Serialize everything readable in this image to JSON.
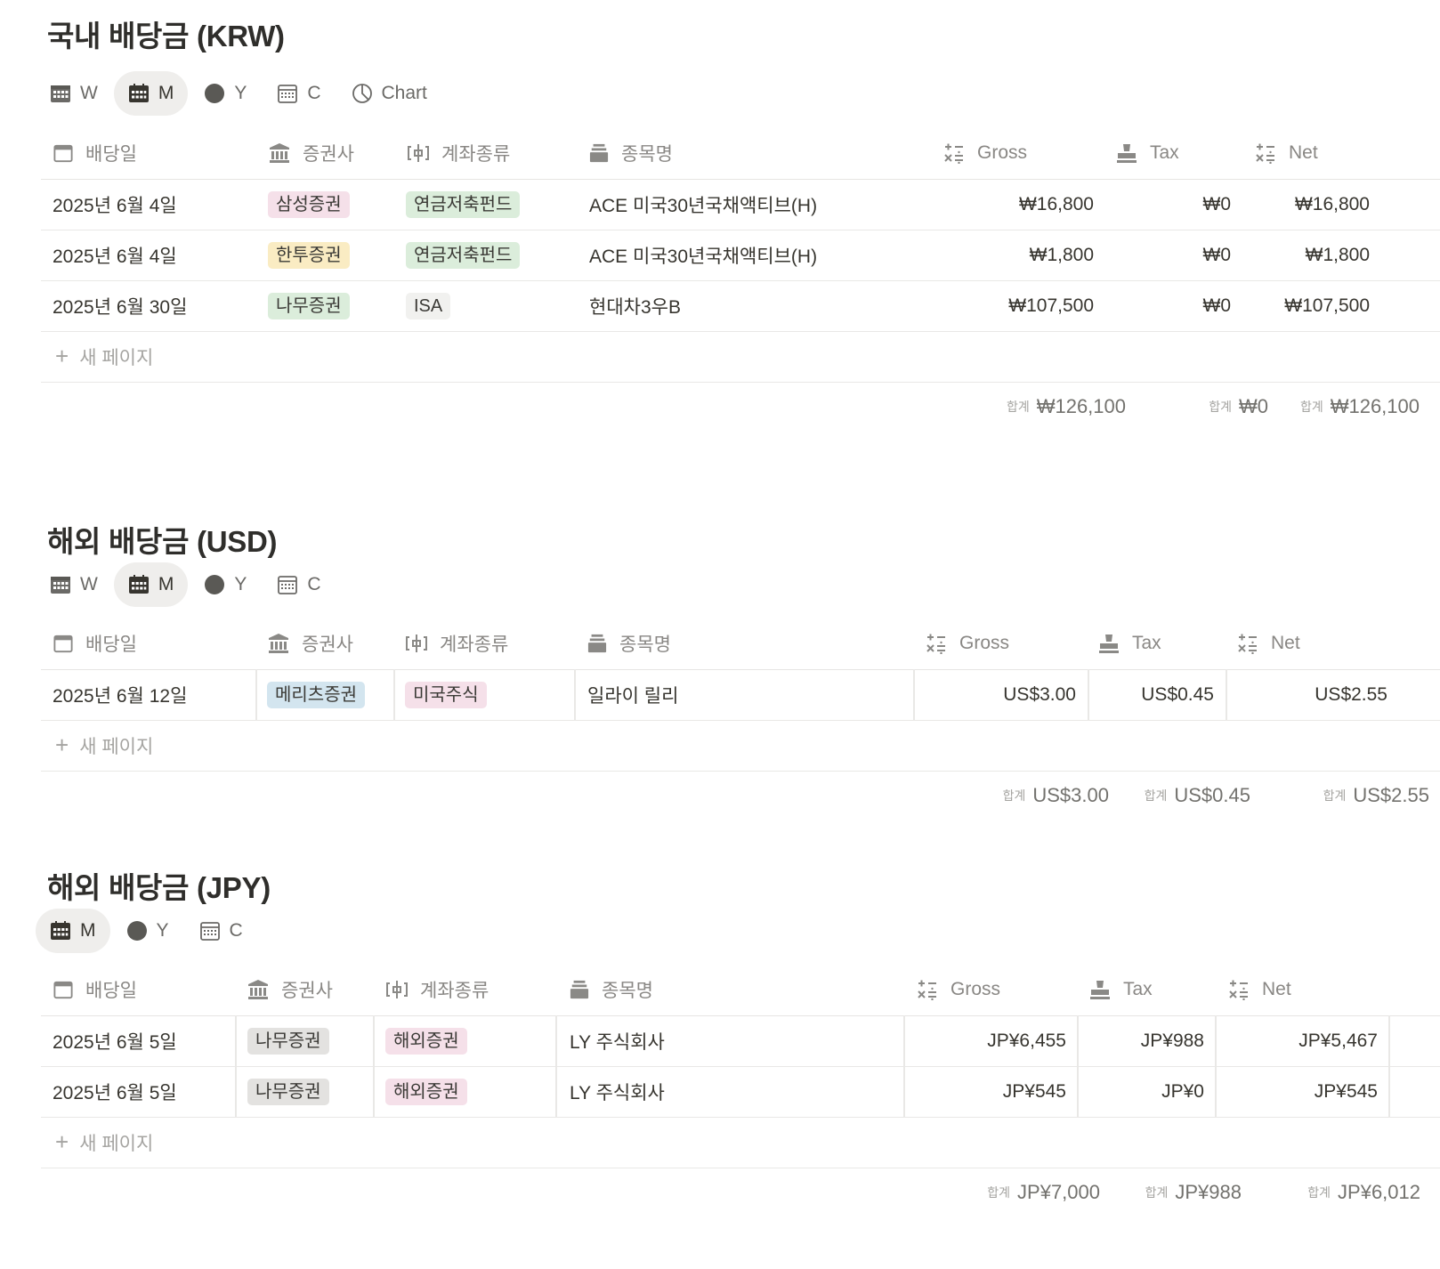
{
  "new_page_label": "새 페이지",
  "sum_label": "합계",
  "colors": {
    "pink": "#f5e0e9",
    "yellow": "#faecc3",
    "green": "#dbeddb",
    "gray": "#e3e2e0",
    "lightgray": "#f1f1ef",
    "blue": "#d3e5ef"
  },
  "krw": {
    "title": "국내 배당금 (KRW)",
    "tabs": [
      "W",
      "M",
      "Y",
      "C",
      "Chart"
    ],
    "active_tab": "M",
    "headers": {
      "date": "배당일",
      "broker": "증권사",
      "account": "계좌종류",
      "stock": "종목명",
      "gross": "Gross",
      "tax": "Tax",
      "net": "Net"
    },
    "rows": [
      {
        "date": "2025년 6월 4일",
        "broker": "삼성증권",
        "broker_color": "pink",
        "account": "연금저축펀드",
        "account_color": "green",
        "stock": "ACE 미국30년국채액티브(H)",
        "gross": "₩16,800",
        "tax": "₩0",
        "net": "₩16,800"
      },
      {
        "date": "2025년 6월 4일",
        "broker": "한투증권",
        "broker_color": "yellow",
        "account": "연금저축펀드",
        "account_color": "green",
        "stock": "ACE 미국30년국채액티브(H)",
        "gross": "₩1,800",
        "tax": "₩0",
        "net": "₩1,800"
      },
      {
        "date": "2025년 6월 30일",
        "broker": "나무증권",
        "broker_color": "green",
        "account": "ISA",
        "account_color": "lightgray",
        "stock": "현대차3우B",
        "gross": "₩107,500",
        "tax": "₩0",
        "net": "₩107,500"
      }
    ],
    "totals": {
      "gross": "₩126,100",
      "tax": "₩0",
      "net": "₩126,100"
    }
  },
  "usd": {
    "title": "해외 배당금 (USD)",
    "tabs": [
      "W",
      "M",
      "Y",
      "C"
    ],
    "active_tab": "M",
    "headers": {
      "date": "배당일",
      "broker": "증권사",
      "account": "계좌종류",
      "stock": "종목명",
      "gross": "Gross",
      "tax": "Tax",
      "net": "Net"
    },
    "rows": [
      {
        "date": "2025년 6월 12일",
        "broker": "메리츠증권",
        "broker_color": "blue",
        "account": "미국주식",
        "account_color": "pink",
        "stock": "일라이 릴리",
        "gross": "US$3.00",
        "tax": "US$0.45",
        "net": "US$2.55"
      }
    ],
    "totals": {
      "gross": "US$3.00",
      "tax": "US$0.45",
      "net": "US$2.55"
    }
  },
  "jpy": {
    "title": "해외 배당금 (JPY)",
    "tabs": [
      "M",
      "Y",
      "C"
    ],
    "active_tab": "M",
    "headers": {
      "date": "배당일",
      "broker": "증권사",
      "account": "계좌종류",
      "stock": "종목명",
      "gross": "Gross",
      "tax": "Tax",
      "net": "Net"
    },
    "rows": [
      {
        "date": "2025년 6월 5일",
        "broker": "나무증권",
        "broker_color": "gray",
        "account": "해외증권",
        "account_color": "pink",
        "stock": "LY 주식회사",
        "gross": "JP¥6,455",
        "tax": "JP¥988",
        "net": "JP¥5,467"
      },
      {
        "date": "2025년 6월 5일",
        "broker": "나무증권",
        "broker_color": "gray",
        "account": "해외증권",
        "account_color": "pink",
        "stock": "LY 주식회사",
        "gross": "JP¥545",
        "tax": "JP¥0",
        "net": "JP¥545"
      }
    ],
    "totals": {
      "gross": "JP¥7,000",
      "tax": "JP¥988",
      "net": "JP¥6,012"
    }
  }
}
